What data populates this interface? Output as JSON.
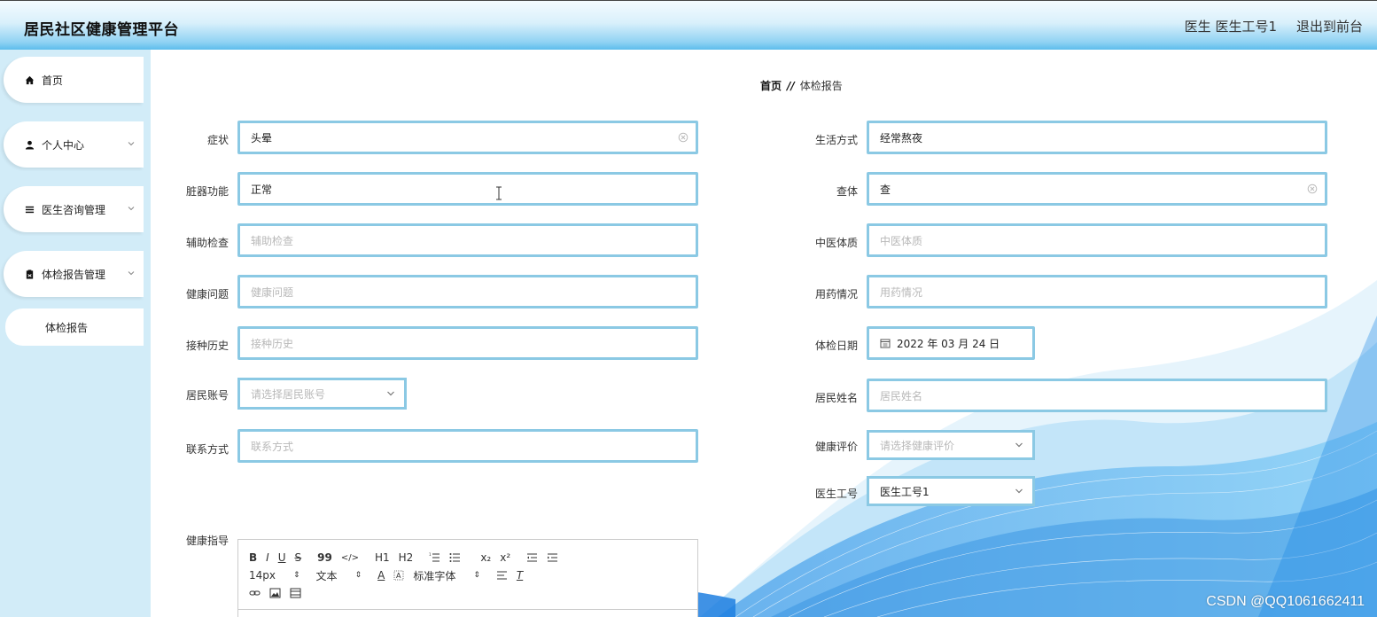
{
  "header": {
    "title": "居民社区健康管理平台",
    "user_info": "医生 医生工号1",
    "logout_label": "退出到前台"
  },
  "sidebar": {
    "items": [
      {
        "label": "首页",
        "icon": "home-icon"
      },
      {
        "label": "个人中心",
        "icon": "user-icon"
      },
      {
        "label": "医生咨询管理",
        "icon": "list-icon"
      },
      {
        "label": "体检报告管理",
        "icon": "clipboard-icon"
      }
    ],
    "sub_item": "体检报告"
  },
  "breadcrumb": {
    "home": "首页",
    "separator": "//",
    "current": "体检报告"
  },
  "form": {
    "symptom": {
      "label": "症状",
      "value": "头晕"
    },
    "organ": {
      "label": "脏器功能",
      "value": "正常"
    },
    "aux_exam": {
      "label": "辅助检查",
      "placeholder": "辅助检查"
    },
    "health_issue": {
      "label": "健康问题",
      "placeholder": "健康问题"
    },
    "vaccination": {
      "label": "接种历史",
      "placeholder": "接种历史"
    },
    "resident_account": {
      "label": "居民账号",
      "placeholder": "请选择居民账号"
    },
    "contact": {
      "label": "联系方式",
      "placeholder": "联系方式"
    },
    "lifestyle": {
      "label": "生活方式",
      "value": "经常熬夜"
    },
    "physical": {
      "label": "查体",
      "value": "查"
    },
    "tcm": {
      "label": "中医体质",
      "placeholder": "中医体质"
    },
    "medication": {
      "label": "用药情况",
      "placeholder": "用药情况"
    },
    "exam_date": {
      "label": "体检日期",
      "value": "2022 年 03 月 24 日"
    },
    "resident_name": {
      "label": "居民姓名",
      "placeholder": "居民姓名"
    },
    "health_eval": {
      "label": "健康评价",
      "placeholder": "请选择健康评价"
    },
    "doctor_id": {
      "label": "医生工号",
      "value": "医生工号1"
    },
    "guidance": {
      "label": "健康指导"
    }
  },
  "editor": {
    "row1": [
      "B",
      "I",
      "U",
      "S",
      "99",
      "</>",
      "H1",
      "H2",
      "ol",
      "ul",
      "x₂",
      "x²",
      "outdent",
      "indent"
    ],
    "size": "14px",
    "para": "文本",
    "font": "标准字体"
  },
  "watermark": "CSDN @QQ1061662411",
  "colors": {
    "field_border": "#8bc9e4",
    "sidebar_bg": "#d2ecf8",
    "header_accent": "#5cbcec"
  }
}
